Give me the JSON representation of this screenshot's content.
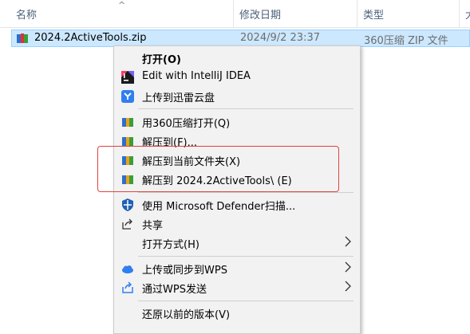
{
  "columns": {
    "name": "名称",
    "modified": "修改日期",
    "type": "类型",
    "more": "大"
  },
  "file": {
    "name": "2024.2ActiveTools.zip",
    "modified": "2024/9/2 23:37",
    "type": "360压缩 ZIP 文件",
    "icon": "zip-archive-icon"
  },
  "menu": {
    "open": "打开(O)",
    "edit_intellij": "Edit with IntelliJ IDEA",
    "upload_xunlei": "上传到迅雷云盘",
    "open_360zip": "用360压缩打开(Q)",
    "extract_to": "解压到(F)...",
    "extract_here": "解压到当前文件夹(X)",
    "extract_folder": "解压到 2024.2ActiveTools\\ (E)",
    "defender_scan": "使用 Microsoft Defender扫描...",
    "share": "共享",
    "open_with": "打开方式(H)",
    "upload_wps": "上传或同步到WPS",
    "send_wps": "通过WPS发送",
    "restore_versions": "还原以前的版本(V)"
  },
  "colors": {
    "selection": "#cce8ff",
    "menu_bg": "#f2f2f2",
    "highlight": "#e0443e"
  }
}
